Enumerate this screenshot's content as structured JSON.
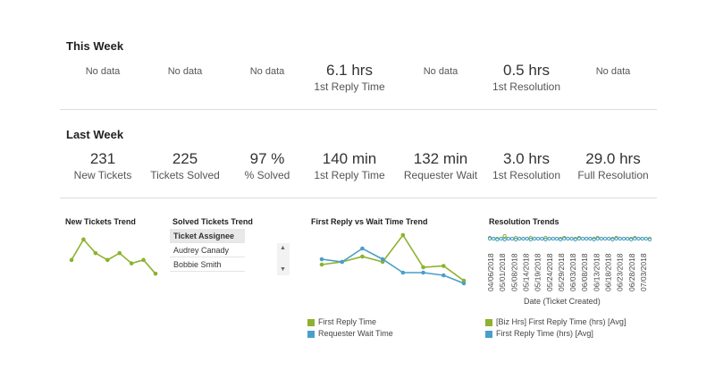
{
  "colors": {
    "green": "#8db22e",
    "blue": "#4a9fc9",
    "title": "#222222",
    "divider": "#dcdcdc"
  },
  "this_week": {
    "title": "This Week",
    "metrics": [
      {
        "nodata": "No data"
      },
      {
        "nodata": "No data"
      },
      {
        "nodata": "No data"
      },
      {
        "value": "6.1 hrs",
        "label": "1st Reply Time"
      },
      {
        "nodata": "No data"
      },
      {
        "value": "0.5 hrs",
        "label": "1st Resolution"
      },
      {
        "nodata": "No data"
      }
    ]
  },
  "last_week": {
    "title": "Last Week",
    "metrics": [
      {
        "value": "231",
        "label": "New Tickets"
      },
      {
        "value": "225",
        "label": "Tickets Solved"
      },
      {
        "value": "97 %",
        "label": "% Solved"
      },
      {
        "value": "140 min",
        "label": "1st Reply Time"
      },
      {
        "value": "132 min",
        "label": "Requester Wait"
      },
      {
        "value": "3.0 hrs",
        "label": "1st Resolution"
      },
      {
        "value": "29.0 hrs",
        "label": "Full Resolution"
      }
    ]
  },
  "widgets": {
    "new_tickets_trend": {
      "title": "New Tickets Trend"
    },
    "solved_tickets_trend": {
      "title": "Solved Tickets Trend",
      "header": "Ticket Assignee",
      "rows": [
        "Audrey Canady",
        "Bobbie Smith"
      ]
    },
    "reply_wait_trend": {
      "title": "First Reply vs Wait Time Trend",
      "legend": [
        "First Reply Time",
        "Requester Wait Time"
      ]
    },
    "resolution_trends": {
      "title": "Resolution Trends",
      "xlabel": "Date (Ticket Created)",
      "legend": [
        "[Biz Hrs] First Reply Time (hrs) [Avg]",
        "First Reply Time (hrs) [Avg]"
      ]
    }
  },
  "chart_data": [
    {
      "type": "line",
      "title": "New Tickets Trend",
      "x": [
        1,
        2,
        3,
        4,
        5,
        6,
        7,
        8
      ],
      "series": [
        {
          "values": [
            8,
            14,
            10,
            8,
            10,
            7,
            8,
            4
          ]
        }
      ]
    },
    {
      "type": "line",
      "title": "First Reply vs Wait Time Trend",
      "x": [
        1,
        2,
        3,
        4,
        5,
        6,
        7,
        8
      ],
      "series": [
        {
          "name": "First Reply Time",
          "values": [
            8,
            9,
            11,
            9,
            19,
            7,
            7.5,
            2
          ]
        },
        {
          "name": "Requester Wait Time",
          "values": [
            10,
            9,
            14,
            10,
            5,
            5,
            4,
            1
          ]
        }
      ]
    },
    {
      "type": "line",
      "title": "Resolution Trends",
      "xlabel": "Date (Ticket Created)",
      "categories": [
        "04/06/2018",
        "05/01/2018",
        "05/08/2018",
        "05/14/2018",
        "05/19/2018",
        "05/24/2018",
        "05/29/2018",
        "06/03/2018",
        "06/08/2018",
        "06/13/2018",
        "06/18/2018",
        "06/23/2018",
        "06/28/2018",
        "07/03/2018"
      ],
      "series": [
        {
          "name": "[Biz Hrs] First Reply Time (hrs) [Avg]",
          "values": [
            4,
            3,
            3,
            3,
            6,
            3,
            3,
            4,
            3,
            3,
            3,
            4,
            3,
            3,
            3,
            4,
            3,
            3,
            3,
            3,
            4,
            3,
            3,
            3,
            4,
            3,
            3,
            3,
            3,
            4,
            3,
            3,
            3,
            3,
            4,
            3,
            3,
            3,
            3,
            4,
            3,
            3,
            3,
            3
          ]
        },
        {
          "name": "First Reply Time (hrs) [Avg]",
          "values": [
            3,
            3,
            2,
            3,
            2,
            3,
            3,
            2,
            3,
            3,
            3,
            2,
            3,
            3,
            3,
            2,
            3,
            3,
            3,
            2,
            3,
            3,
            3,
            2,
            3,
            3,
            3,
            3,
            2,
            3,
            3,
            3,
            3,
            2,
            3,
            3,
            3,
            3,
            2,
            3,
            3,
            3,
            3,
            2
          ]
        }
      ]
    }
  ]
}
